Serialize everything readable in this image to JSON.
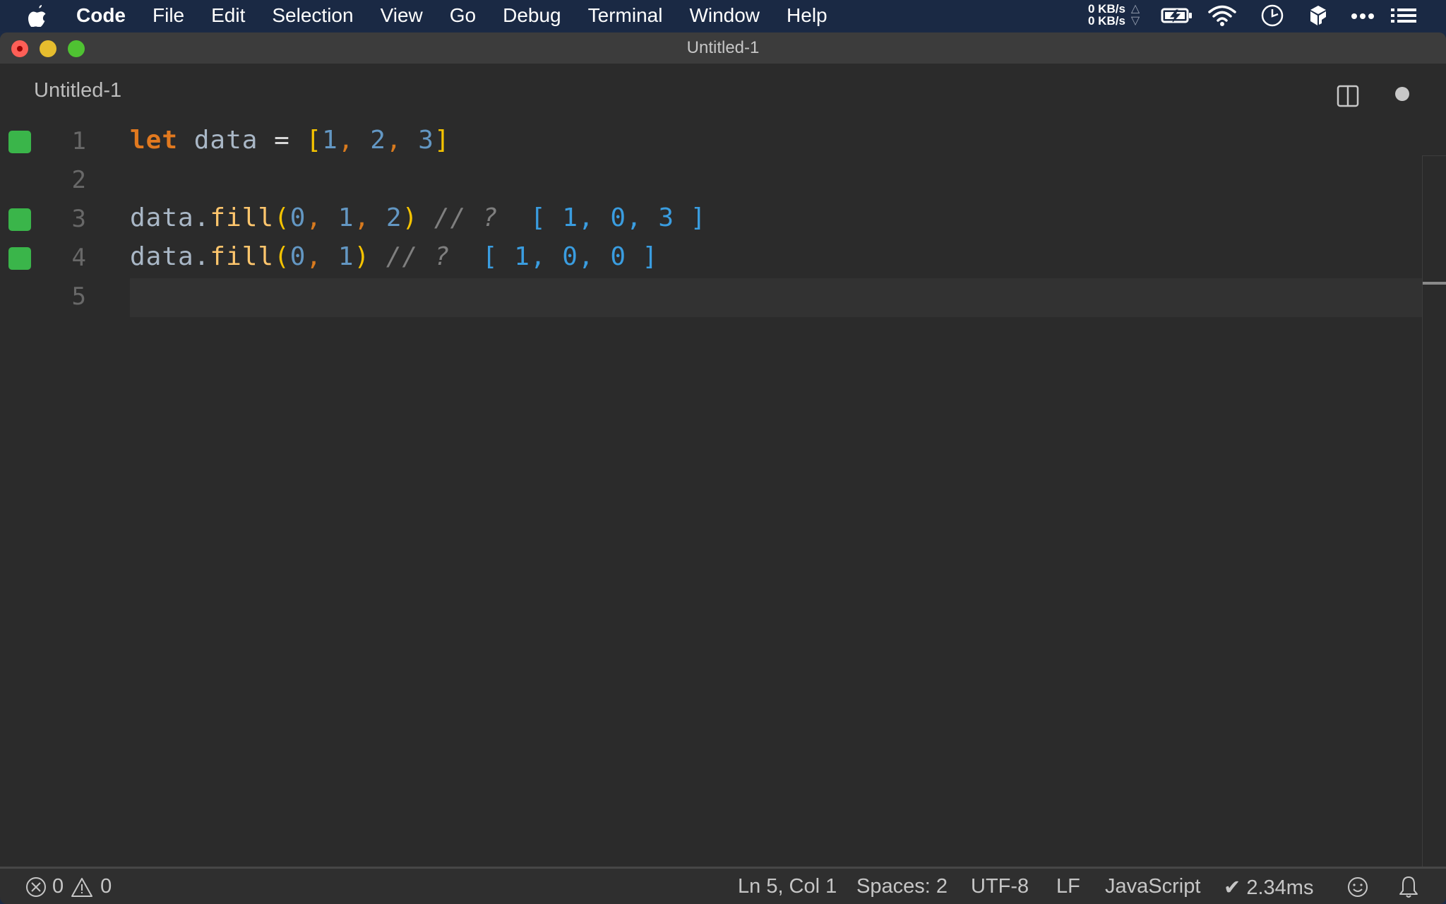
{
  "menubar": {
    "apple_icon": "apple-logo-icon",
    "items": [
      {
        "label": "Code",
        "bold": true
      },
      {
        "label": "File"
      },
      {
        "label": "Edit"
      },
      {
        "label": "Selection"
      },
      {
        "label": "View"
      },
      {
        "label": "Go"
      },
      {
        "label": "Debug"
      },
      {
        "label": "Terminal"
      },
      {
        "label": "Window"
      },
      {
        "label": "Help"
      }
    ],
    "tray": {
      "upload_speed": "0 KB/s",
      "download_speed": "0 KB/s",
      "upload_arrow": "△",
      "download_arrow": "▽",
      "icons": [
        "battery-charging-icon",
        "wifi-icon",
        "clock-icon",
        "box-app-icon",
        "more-dots-icon",
        "list-menu-icon"
      ]
    }
  },
  "window": {
    "title": "Untitled-1",
    "tab": {
      "label": "Untitled-1",
      "dirty": true
    },
    "actions": [
      "split-editor-icon",
      "unsaved-dot-icon"
    ]
  },
  "editor": {
    "cursor": {
      "line": 5,
      "col": 1
    },
    "lines": [
      {
        "number": "1",
        "marker": true,
        "tokens": [
          {
            "t": "let",
            "c": "kw"
          },
          {
            "t": " ",
            "c": "var"
          },
          {
            "t": "data",
            "c": "var"
          },
          {
            "t": " ",
            "c": "var"
          },
          {
            "t": "=",
            "c": "op"
          },
          {
            "t": " ",
            "c": "var"
          },
          {
            "t": "[",
            "c": "br"
          },
          {
            "t": "1",
            "c": "num"
          },
          {
            "t": ", ",
            "c": "comma"
          },
          {
            "t": "2",
            "c": "num"
          },
          {
            "t": ", ",
            "c": "comma"
          },
          {
            "t": "3",
            "c": "num"
          },
          {
            "t": "]",
            "c": "br"
          }
        ]
      },
      {
        "number": "2",
        "marker": false,
        "tokens": []
      },
      {
        "number": "3",
        "marker": true,
        "tokens": [
          {
            "t": "data",
            "c": "var"
          },
          {
            "t": ".",
            "c": "var"
          },
          {
            "t": "fill",
            "c": "fn"
          },
          {
            "t": "(",
            "c": "br"
          },
          {
            "t": "0",
            "c": "num"
          },
          {
            "t": ", ",
            "c": "comma"
          },
          {
            "t": "1",
            "c": "num"
          },
          {
            "t": ", ",
            "c": "comma"
          },
          {
            "t": "2",
            "c": "num"
          },
          {
            "t": ")",
            "c": "br"
          },
          {
            "t": " // ? ",
            "c": "cmt"
          },
          {
            "t": " [ 1, 0, 3 ]",
            "c": "res"
          }
        ]
      },
      {
        "number": "4",
        "marker": true,
        "tokens": [
          {
            "t": "data",
            "c": "var"
          },
          {
            "t": ".",
            "c": "var"
          },
          {
            "t": "fill",
            "c": "fn"
          },
          {
            "t": "(",
            "c": "br"
          },
          {
            "t": "0",
            "c": "num"
          },
          {
            "t": ", ",
            "c": "comma"
          },
          {
            "t": "1",
            "c": "num"
          },
          {
            "t": ")",
            "c": "br"
          },
          {
            "t": " // ? ",
            "c": "cmt"
          },
          {
            "t": " [ 1, 0, 0 ]",
            "c": "res"
          }
        ]
      },
      {
        "number": "5",
        "marker": false,
        "current": true,
        "tokens": []
      }
    ],
    "colors": {
      "keyword": "#e1791f",
      "variable": "#a9b7c6",
      "bracket": "#f5c300",
      "number": "#6397c3",
      "function": "#ffc66d",
      "comment": "#7f7f7f",
      "result": "#3a9de0",
      "marker": "#3ab54a"
    }
  },
  "statusbar": {
    "errors": "0",
    "warnings": "0",
    "position": "Ln 5, Col 1",
    "indent": "Spaces: 2",
    "encoding": "UTF-8",
    "eol": "LF",
    "language": "JavaScript",
    "timing": "✔ 2.34ms",
    "feedback_icon": "smiley-icon",
    "notifications_icon": "bell-icon"
  }
}
